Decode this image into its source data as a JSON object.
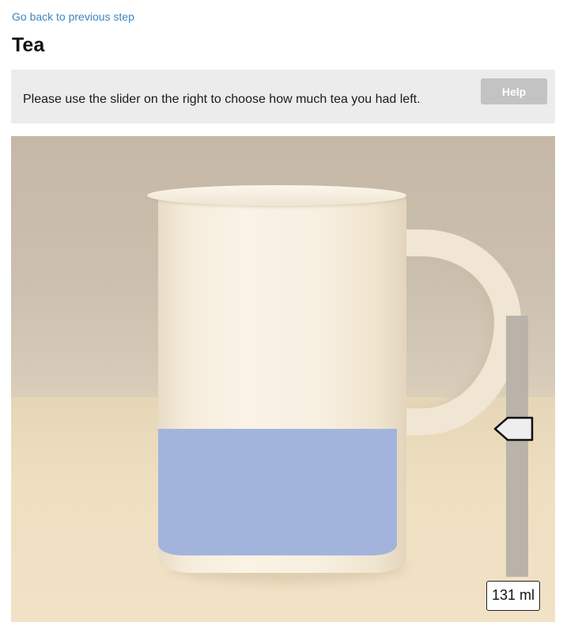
{
  "nav": {
    "back_label": "Go back to previous step"
  },
  "page": {
    "title": "Tea"
  },
  "instruction": {
    "text": "Please use the slider on the right to choose how much tea you had left.",
    "help_label": "Help"
  },
  "portion": {
    "item": "mug",
    "fill_fraction": 0.4,
    "fill_color": "#a3b4dc",
    "slider_position_fraction": 0.43,
    "readout": "131 ml"
  },
  "colors": {
    "link": "#3d86c2",
    "panel_bg": "#ececec",
    "help_button_bg": "#c3c3c3",
    "slider_track": "#b9b3aa",
    "slider_handle": "#eeeeee"
  },
  "icons": {
    "slider_handle": "pentagon-arrow-left"
  }
}
